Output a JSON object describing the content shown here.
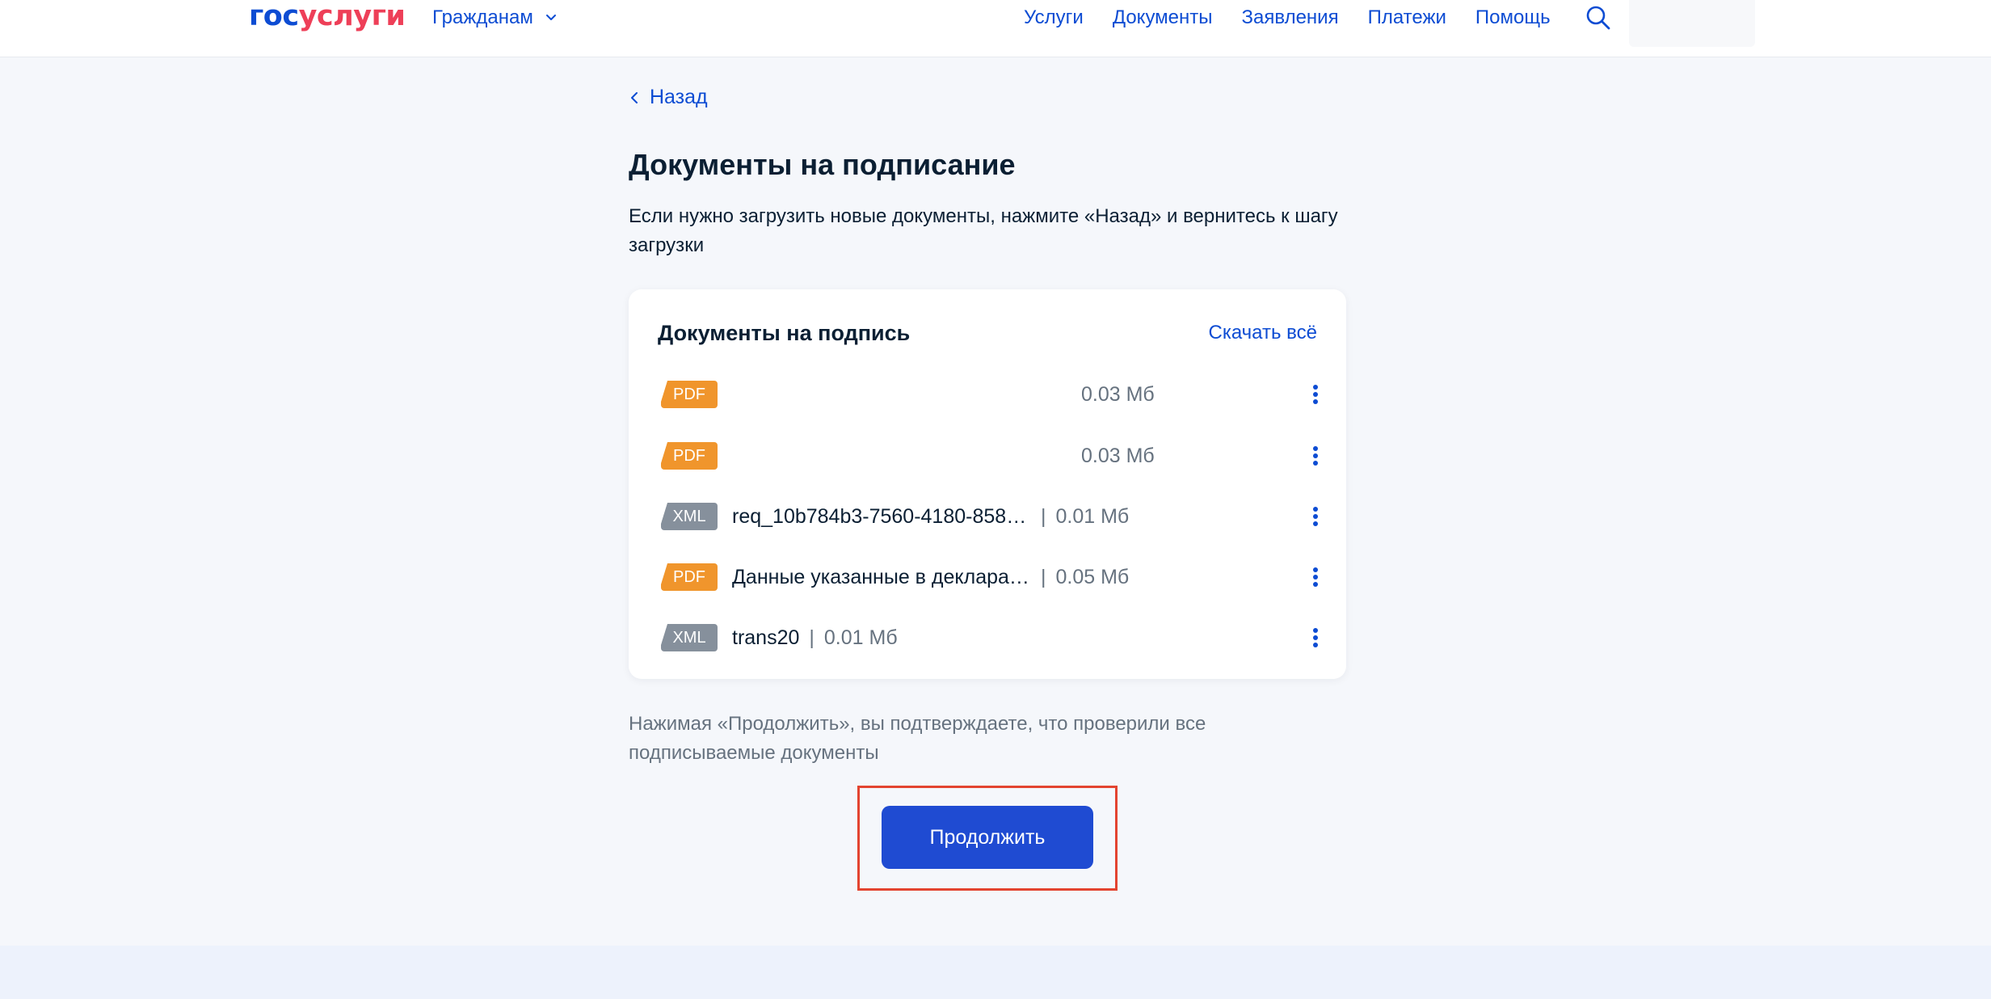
{
  "header": {
    "logo": {
      "part1": "гос",
      "part2": "услуги"
    },
    "citizen_menu": "Гражданам",
    "nav": [
      "Услуги",
      "Документы",
      "Заявления",
      "Платежи",
      "Помощь"
    ],
    "icons": {
      "search": "search-icon",
      "dropdown": "chevron-down-icon"
    }
  },
  "back": {
    "label": "Назад",
    "icon": "chevron-left-icon"
  },
  "page": {
    "title": "Документы на подписание",
    "intro": "Если нужно загрузить новые документы, нажмите «Назад» и вернитесь к шагу загрузки"
  },
  "card": {
    "title": "Документы на подпись",
    "download_all": "Скачать всё",
    "documents": [
      {
        "type": "PDF",
        "name": "",
        "size": "0.03 Мб"
      },
      {
        "type": "PDF",
        "name": "",
        "size": "0.03 Мб"
      },
      {
        "type": "XML",
        "name": "req_10b784b3-7560-4180-858d...",
        "size": "0.01 Мб"
      },
      {
        "type": "PDF",
        "name": "Данные указанные в декларац...",
        "size": "0.05 Мб"
      },
      {
        "type": "XML",
        "name": "trans20",
        "size": "0.01 Мб"
      }
    ],
    "separator": "|"
  },
  "confirm_note": "Нажимая «Продолжить», вы подтверждаете, что проверили все подписываемые документы",
  "continue_button": "Продолжить",
  "colors": {
    "brand_blue": "#0d4cd3",
    "brand_red": "#ee3f58",
    "button": "#1f4bd2",
    "highlight": "#e34430",
    "pdf_badge": "#f0952c",
    "xml_badge": "#86909c"
  }
}
